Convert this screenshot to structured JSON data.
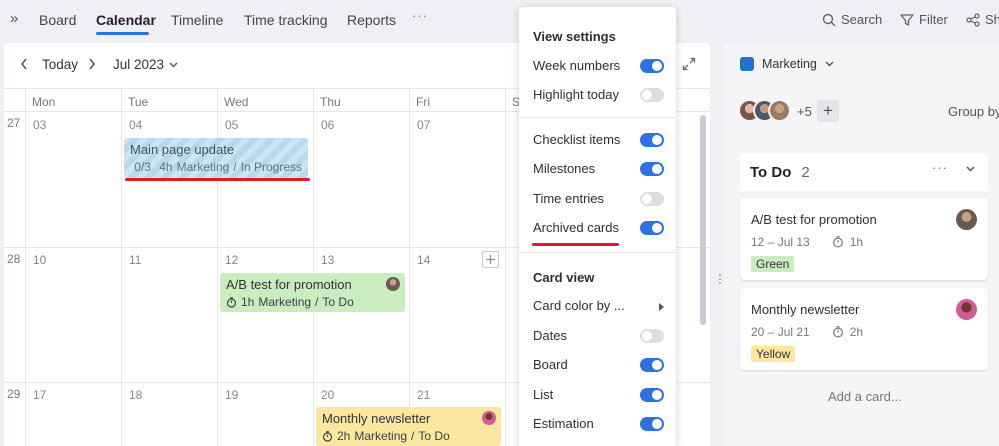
{
  "nav": {
    "collapse": "»",
    "tabs": [
      "Board",
      "Calendar",
      "Timeline",
      "Time tracking",
      "Reports"
    ],
    "more": "···",
    "search": "Search",
    "filter": "Filter",
    "share": "Sh"
  },
  "calendar": {
    "today_label": "Today",
    "month_label": "Jul 2023",
    "days_of_week": [
      "Mon",
      "Tue",
      "Wed",
      "Thu",
      "Fri",
      "S"
    ],
    "weeks": [
      {
        "week": "27",
        "dates": [
          "03",
          "04",
          "05",
          "06",
          "07"
        ]
      },
      {
        "week": "28",
        "dates": [
          "10",
          "11",
          "12",
          "13",
          "14"
        ]
      },
      {
        "week": "29",
        "dates": [
          "17",
          "18",
          "19",
          "20",
          "21"
        ]
      }
    ],
    "events": {
      "main_page": {
        "title": "Main page update",
        "checklist": "0/3",
        "estimate": "4h",
        "board": "Marketing",
        "sep": "/",
        "status": "In Progress"
      },
      "ab_test": {
        "title": "A/B test for promotion",
        "estimate": "1h",
        "board": "Marketing",
        "sep": "/",
        "status": "To Do"
      },
      "newsletter": {
        "title": "Monthly newsletter",
        "estimate": "2h",
        "board": "Marketing",
        "sep": "/",
        "status": "To Do"
      }
    },
    "highlight_color": "#e0182c"
  },
  "menu": {
    "view_settings_title": "View settings",
    "view_settings": [
      {
        "label": "Week numbers",
        "on": true
      },
      {
        "label": "Highlight today",
        "on": false
      }
    ],
    "display": [
      {
        "label": "Checklist items",
        "on": true
      },
      {
        "label": "Milestones",
        "on": true
      },
      {
        "label": "Time entries",
        "on": false
      },
      {
        "label": "Archived cards",
        "on": true
      }
    ],
    "card_view_title": "Card view",
    "card_color_label": "Card color by ...",
    "card_view": [
      {
        "label": "Dates",
        "on": false
      },
      {
        "label": "Board",
        "on": true
      },
      {
        "label": "List",
        "on": true
      },
      {
        "label": "Estimation",
        "on": true
      }
    ],
    "toggle_on_color": "#2d72e0"
  },
  "sidebar": {
    "board_name": "Marketing",
    "extra_members": "+5",
    "add_member": "+",
    "group_by": "Group by",
    "column": {
      "title": "To Do",
      "count": "2",
      "more": "···"
    },
    "cards": [
      {
        "title": "A/B test for promotion",
        "dates": "12 – Jul 13",
        "estimate": "1h",
        "tag": "Green",
        "tag_color": "#c9edbf"
      },
      {
        "title": "Monthly newsletter",
        "dates": "20 – Jul 21",
        "estimate": "2h",
        "tag": "Yellow",
        "tag_color": "#fbe7a0"
      }
    ],
    "add_card": "Add a card..."
  },
  "icons": [
    "search-icon",
    "filter-icon",
    "share-icon",
    "chevron-left-icon",
    "chevron-right-icon",
    "chevron-down-icon",
    "expand-icon",
    "checklist-icon",
    "timer-icon",
    "drag-handle-icon",
    "add-icon",
    "submenu-arrow-icon"
  ]
}
